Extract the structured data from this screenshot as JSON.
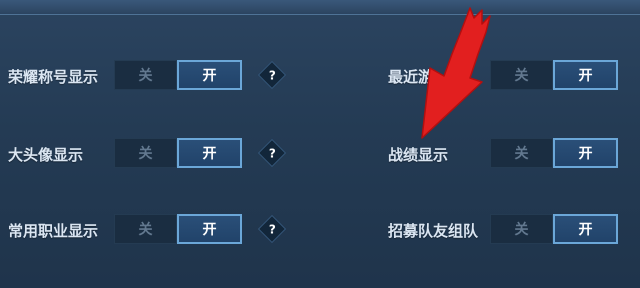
{
  "settings": {
    "left": [
      {
        "label": "荣耀称号显示",
        "off_label": "关",
        "on_label": "开",
        "help_icon": "?"
      },
      {
        "label": "大头像显示",
        "off_label": "关",
        "on_label": "开",
        "help_icon": "?"
      },
      {
        "label": "常用职业显示",
        "off_label": "关",
        "on_label": "开",
        "help_icon": "?"
      }
    ],
    "right": [
      {
        "label": "最近游",
        "off_label": "关",
        "on_label": "开"
      },
      {
        "label": "战绩显示",
        "off_label": "关",
        "on_label": "开"
      },
      {
        "label": "招募队友组队",
        "off_label": "关",
        "on_label": "开"
      }
    ]
  },
  "annotation": {
    "arrow_color": "#e21f1f"
  }
}
